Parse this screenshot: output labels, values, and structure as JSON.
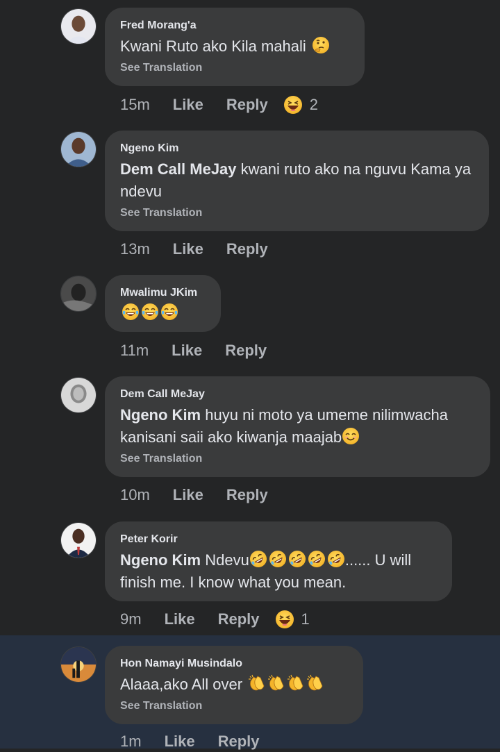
{
  "comments": [
    {
      "author": "Fred Morang'a",
      "mention": "",
      "text": "Kwani Ruto ako Kila mahali",
      "emojis": [
        "thinking"
      ],
      "see_translation": "See Translation",
      "time": "15m",
      "like": "Like",
      "reply": "Reply",
      "reaction": "haha",
      "reaction_count": "2"
    },
    {
      "author": "Ngeno Kim",
      "mention": "Dem Call MeJay",
      "text": "kwani ruto ako na nguvu Kama ya ndevu",
      "emojis": [],
      "see_translation": "See Translation",
      "time": "13m",
      "like": "Like",
      "reply": "Reply",
      "reaction": "",
      "reaction_count": ""
    },
    {
      "author": "Mwalimu JKim",
      "mention": "",
      "text": "",
      "emojis": [
        "tears-of-joy",
        "tears-of-joy",
        "tears-of-joy"
      ],
      "see_translation": "",
      "time": "11m",
      "like": "Like",
      "reply": "Reply",
      "reaction": "",
      "reaction_count": ""
    },
    {
      "author": "Dem Call MeJay",
      "mention": "Ngeno Kim",
      "text": "huyu ni moto ya umeme nilimwacha kanisani saii ako kiwanja maajab",
      "emojis": [
        "smiling-blush"
      ],
      "see_translation": "See Translation",
      "time": "10m",
      "like": "Like",
      "reply": "Reply",
      "reaction": "",
      "reaction_count": ""
    },
    {
      "author": "Peter Korir",
      "mention": "Ngeno Kim",
      "text_a": "Ndevu",
      "emojis": [
        "rofl",
        "rofl",
        "rofl",
        "rofl",
        "rofl"
      ],
      "text_b": "...... U will",
      "text_c": "finish me. I know what you mean.",
      "see_translation": "",
      "time": "9m",
      "like": "Like",
      "reply": "Reply",
      "reaction": "haha",
      "reaction_count": "1"
    },
    {
      "author": "Hon Namayi Musindalo",
      "mention": "",
      "text": "Alaaa,ako All over",
      "emojis": [
        "clapping",
        "clapping",
        "clapping",
        "clapping"
      ],
      "see_translation": "See Translation",
      "time": "1m",
      "like": "Like",
      "reply": "Reply",
      "reaction": "",
      "reaction_count": ""
    }
  ],
  "colors": {
    "background": "#242526",
    "bubble": "#3a3b3c",
    "highlight": "#263040",
    "text": "#e4e6eb",
    "muted": "#b0b3b8",
    "emoji_yellow": "#f7c33b"
  }
}
